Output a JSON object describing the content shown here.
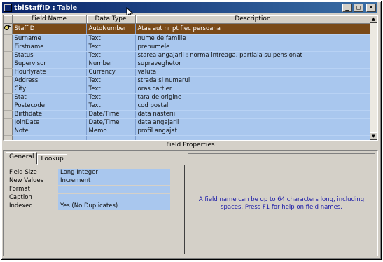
{
  "window": {
    "title": "tblStaffID : Table",
    "buttons": {
      "minimize": "_",
      "maximize": "□",
      "close": "×"
    }
  },
  "grid": {
    "headers": [
      "Field Name",
      "Data Type",
      "Description"
    ],
    "rows": [
      [
        "StaffID",
        "AutoNumber",
        "Atas aut nr pt fiec persoana"
      ],
      [
        "Surname",
        "Text",
        "nume de familie"
      ],
      [
        "Firstname",
        "Text",
        "prenumele"
      ],
      [
        "Status",
        "Text",
        "starea angajarii : norma intreaga, partiala su pensionat"
      ],
      [
        "Supervisor",
        "Number",
        "supraveghetor"
      ],
      [
        "Hourlyrate",
        "Currency",
        "valuta"
      ],
      [
        "Address",
        "Text",
        "strada si numarul"
      ],
      [
        "City",
        "Text",
        "oras cartier"
      ],
      [
        "Stat",
        "Text",
        "tara de origine"
      ],
      [
        "Postecode",
        "Text",
        "cod postal"
      ],
      [
        "Birthdate",
        "Date/Time",
        "data nasterii"
      ],
      [
        "JoinDate",
        "Date/Time",
        "data angajarii"
      ],
      [
        "Note",
        "Memo",
        "profil angajat"
      ],
      [
        "",
        "",
        ""
      ],
      [
        "",
        "",
        ""
      ]
    ]
  },
  "field_properties": {
    "label": "Field Properties",
    "tabs": [
      "General",
      "Lookup"
    ],
    "properties": [
      {
        "label": "Field Size",
        "value": "Long Integer"
      },
      {
        "label": "New Values",
        "value": "Increment"
      },
      {
        "label": "Format",
        "value": ""
      },
      {
        "label": "Caption",
        "value": ""
      },
      {
        "label": "Indexed",
        "value": "Yes (No Duplicates)"
      }
    ],
    "help_text": "A field name can be up to 64 characters long, including spaces.  Press F1 for help on field names."
  },
  "colors": {
    "title_gradient_start": "#0a246a",
    "grid_background": "#a9c7ee",
    "selected_row": "#7a4a18",
    "help_text": "#1a1aa8"
  }
}
